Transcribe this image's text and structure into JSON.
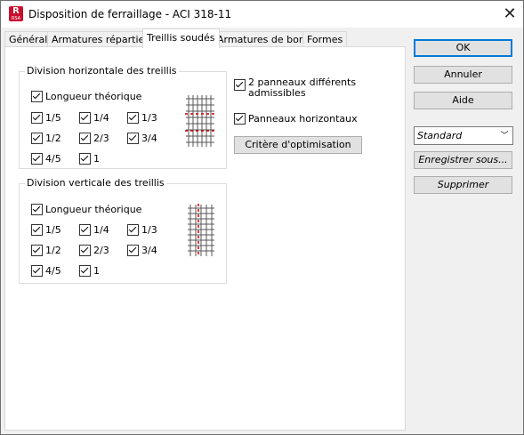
{
  "window": {
    "title": "Disposition de ferraillage - ACI 318-11",
    "app_icon": "R",
    "app_icon_sub": "RSA"
  },
  "tabs": [
    "Général",
    "Armatures réparties",
    "Treillis soudés",
    "Armatures de bord",
    "Formes"
  ],
  "active_tab": "Treillis soudés",
  "horizontal": {
    "title": "Division horizontale des treillis",
    "longueur": "Longueur théorique",
    "fractions": [
      "1/5",
      "1/4",
      "1/3",
      "1/2",
      "2/3",
      "3/4",
      "4/5",
      "1"
    ]
  },
  "vertical": {
    "title": "Division verticale des treillis",
    "longueur": "Longueur théorique",
    "fractions": [
      "1/5",
      "1/4",
      "1/3",
      "1/2",
      "2/3",
      "3/4",
      "4/5",
      "1"
    ]
  },
  "options": {
    "deux_panneaux_line1": "2 panneaux différents",
    "deux_panneaux_line2": "admissibles",
    "panneaux_horizontaux": "Panneaux horizontaux",
    "critere": "Critère d'optimisation"
  },
  "buttons": {
    "ok": "OK",
    "annuler": "Annuler",
    "aide": "Aide",
    "enregistrer": "Enregistrer sous...",
    "supprimer": "Supprimer"
  },
  "preset": {
    "selected": "Standard"
  },
  "colors": {
    "accent": "#0078d7",
    "grid_red": "#cc0000",
    "icon": "#c8102e"
  }
}
